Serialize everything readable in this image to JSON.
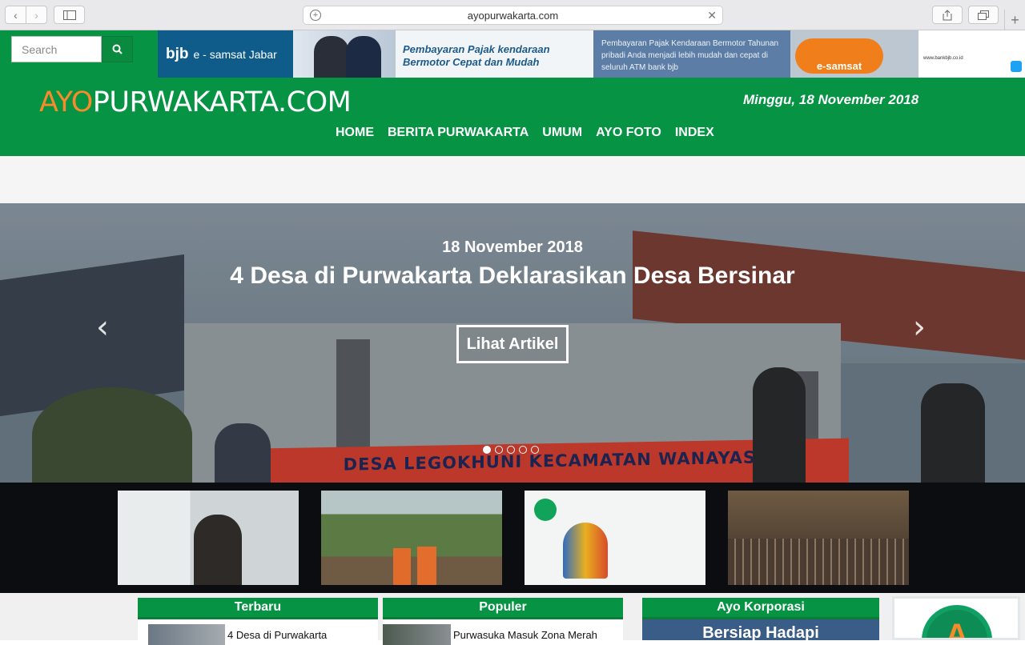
{
  "browser": {
    "url": "ayopurwakarta.com",
    "newtab_label": "+"
  },
  "search": {
    "placeholder": "Search"
  },
  "ad_banner": {
    "brand": "bjb",
    "brand_sub": "e - samsat Jabar",
    "promo": "Pembayaran Pajak kendaraan Bermotor Cepat dan Mudah",
    "description": "Pembayaran Pajak Kendaraan Bermotor Tahunan pribadi Anda menjadi lebih mudah dan cepat di seluruh ATM bank bjb",
    "esamsat_label": "e-samsat",
    "footer": "www.bankbjb.co.id"
  },
  "site": {
    "logo_ayo": "AYO",
    "logo_rest": "PURWAKARTA.COM",
    "date": "Minggu, 18 November 2018"
  },
  "menu": [
    "HOME",
    "BERITA PURWAKARTA",
    "UMUM",
    "AYO FOTO",
    "INDEX"
  ],
  "hero": {
    "date": "18 November 2018",
    "title": "4 Desa di Purwakarta Deklarasikan Desa Bersinar",
    "button": "Lihat Artikel",
    "banner_text": "DESA LEGOKHUNI KECAMATAN WANAYASA",
    "slides_total": 5,
    "active_slide": 1
  },
  "sections": {
    "terbaru": {
      "title": "Terbaru",
      "first_item": "4 Desa di Purwakarta"
    },
    "populer": {
      "title": "Populer",
      "first_item": "Purwasuka Masuk Zona Merah"
    },
    "korporasi": {
      "title": "Ayo Korporasi",
      "preview": "Bersiap Hadapi"
    }
  }
}
